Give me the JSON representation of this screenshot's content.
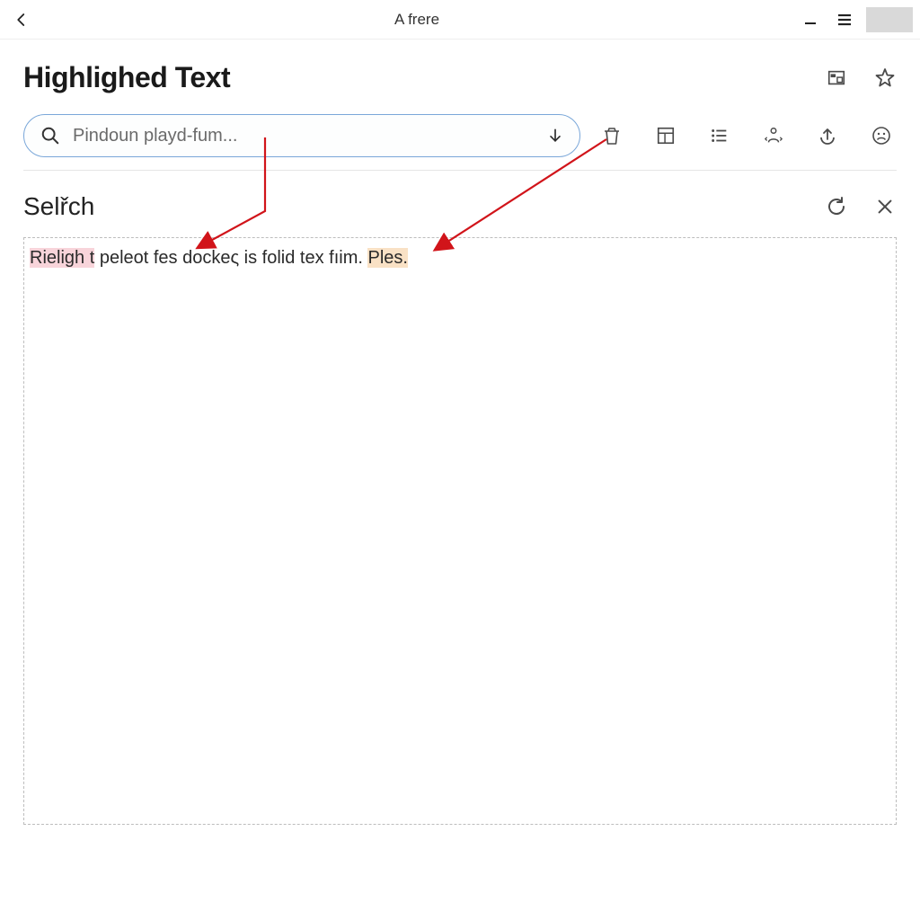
{
  "titlebar": {
    "title": "A frere"
  },
  "header": {
    "page_title": "Highlighed Text"
  },
  "search": {
    "placeholder": "Pindoun playd-fum..."
  },
  "section": {
    "title": "Selřch"
  },
  "body": {
    "highlight1": "Rieligh t",
    "mid": " peleot fes dockeς is folid tex fıim. ",
    "highlight2": "Ples."
  }
}
